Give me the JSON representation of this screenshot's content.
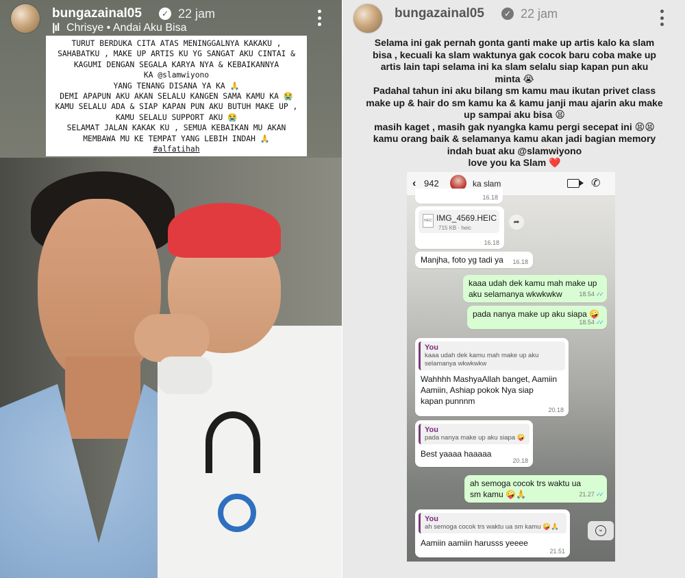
{
  "left_story": {
    "username": "bungazainal05",
    "time_ago": "22 jam",
    "music": "Chrisye • Andai Aku Bisa",
    "caption_lines": [
      "TURUT BERDUKA CITA ATAS MENINGGALNYA KAKAKU ,",
      "SAHABATKU , MAKE UP ARTIS KU YG SANGAT AKU CINTAI &",
      "KAGUMI DENGAN SEGALA KARYA NYA & KEBAIKANNYA",
      "KA @slamwiyono",
      "YANG TENANG DISANA YA KA 🙏",
      "DEMI APAPUN AKU AKAN SELALU KANGEN SAMA KAMU KA 😭",
      "KAMU SELALU ADA & SIAP KAPAN PUN AKU BUTUH MAKE UP ,",
      "KAMU SELALU SUPPORT AKU 😭",
      "SELAMAT JALAN KAKAK KU , SEMUA KEBAIKAN MU AKAN",
      "MEMBAWA MU KE TEMPAT YANG LEBIH INDAH 🙏",
      "#alfatihah"
    ]
  },
  "right_story": {
    "username": "bungazainal05",
    "time_ago": "22 jam",
    "caption_lines": [
      "Selama ini gak pernah gonta ganti make up artis kalo ka slam",
      "bisa , kecuali ka slam waktunya gak cocok baru coba make up",
      "artis lain tapi selama ini ka slam selalu siap kapan pun aku",
      "minta 😭",
      "Padahal tahun ini aku bilang sm kamu mau ikutan privet class",
      "make up & hair do sm kamu ka & kamu janji mau ajarin aku make",
      "up sampai aku bisa 😫",
      "masih kaget , masih gak nyangka kamu pergi secepat ini 😫😫",
      "kamu orang baik & selamanya kamu akan jadi bagian memory",
      "indah buat aku @slamwiyono",
      "love you ka Slam ❤️"
    ]
  },
  "chat": {
    "back_count": "942",
    "contact_name": "ka slam",
    "messages": [
      {
        "type": "time_only",
        "time": "16.18"
      },
      {
        "type": "file",
        "name": "IMG_4569.HEIC",
        "meta": "715 KB · heic",
        "time": "16.18"
      },
      {
        "type": "in",
        "text": "Manjha, foto yg tadi ya",
        "time": "16.18"
      },
      {
        "type": "out",
        "text": "kaaa udah dek kamu mah make up aku selamanya wkwkwkw",
        "time": "18.54"
      },
      {
        "type": "out",
        "text": "pada nanya make up aku siapa 🤪",
        "time": "18.54"
      },
      {
        "type": "reply",
        "quote_from": "You",
        "quote_text": "kaaa udah dek kamu mah make up aku selamanya wkwkwkw",
        "text": "Wahhhh MashyaAllah banget, Aamiin Aamiin, Ashiap pokok Nya siap kapan punnnm",
        "time": "20.18"
      },
      {
        "type": "reply",
        "quote_from": "You",
        "quote_text": "pada nanya make up aku siapa 🤪",
        "text": "Best yaaaa haaaaa",
        "time": "20.18"
      },
      {
        "type": "out",
        "text": "ah semoga cocok trs waktu ua sm kamu 🤪🙏",
        "time": "21.27"
      },
      {
        "type": "reply",
        "quote_from": "You",
        "quote_text": "ah semoga cocok trs waktu ua sm kamu 🤪🙏",
        "text": "Aamiin aamiin harusss yeeee",
        "time": "21.51"
      }
    ]
  },
  "icons": [
    "avatar",
    "verified-badge-icon",
    "music-bars-icon",
    "more-vertical-icon",
    "back-chevron-icon",
    "video-call-icon",
    "phone-icon",
    "file-icon",
    "share-icon",
    "double-check-icon",
    "scroll-down-icon"
  ],
  "colors": {
    "verified": "#ffffff",
    "read_tick": "#4aa3df",
    "outgoing_bubble": "#d9fdd3",
    "quote_name": "#7a2a7a"
  }
}
